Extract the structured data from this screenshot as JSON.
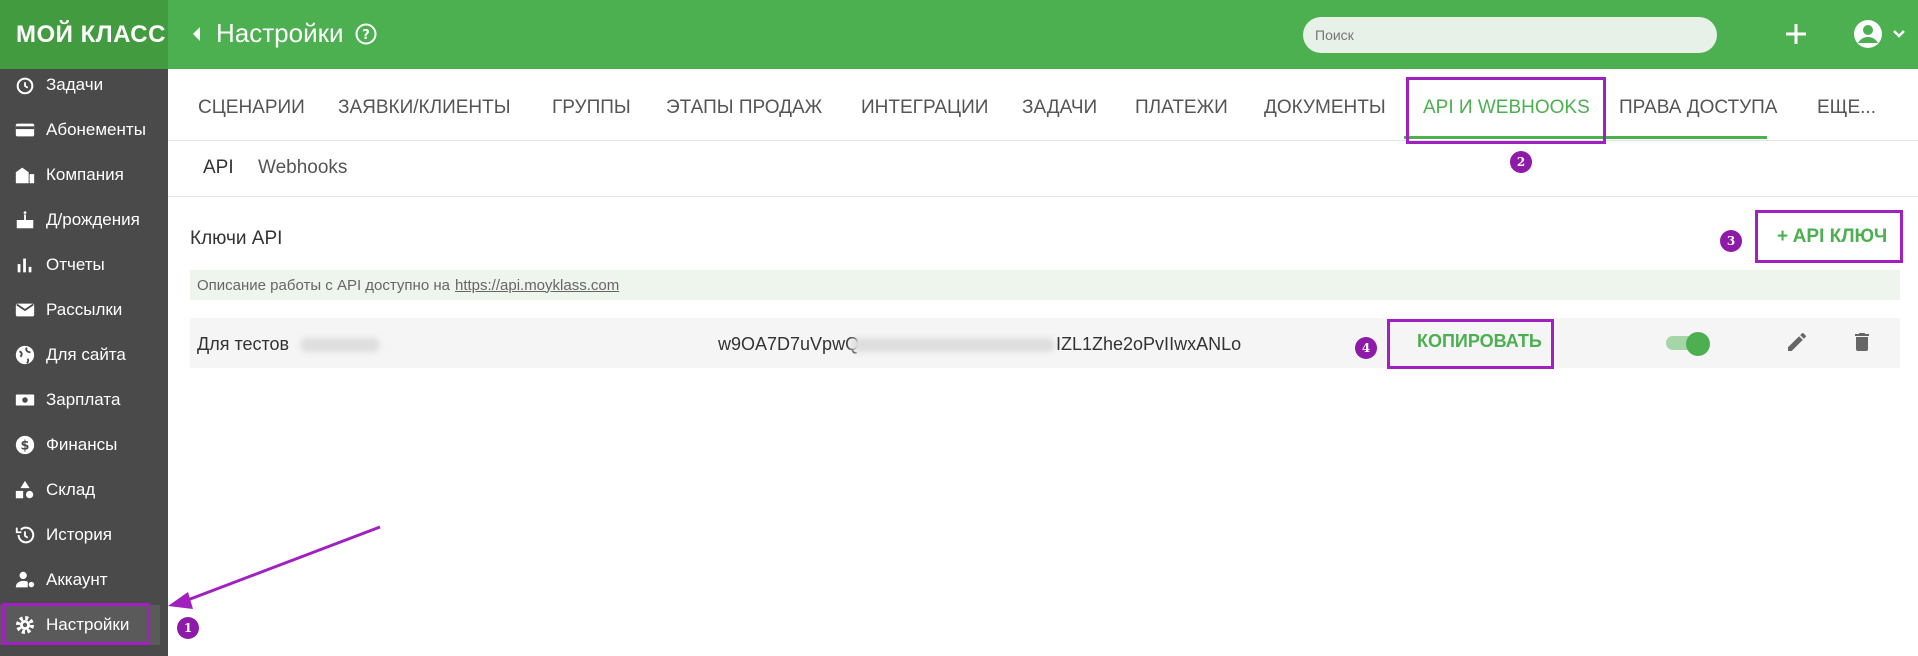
{
  "app": {
    "logo": "МОЙ КЛАСС"
  },
  "sidebar": {
    "items": [
      {
        "label": "Задачи",
        "icon": "clock-icon"
      },
      {
        "label": "Абонементы",
        "icon": "card-icon"
      },
      {
        "label": "Компания",
        "icon": "building-icon"
      },
      {
        "label": "Д/рождения",
        "icon": "cake-icon"
      },
      {
        "label": "Отчеты",
        "icon": "bar-chart-icon"
      },
      {
        "label": "Рассылки",
        "icon": "mail-icon"
      },
      {
        "label": "Для сайта",
        "icon": "globe-icon"
      },
      {
        "label": "Зарплата",
        "icon": "money-icon"
      },
      {
        "label": "Финансы",
        "icon": "dollar-icon"
      },
      {
        "label": "Склад",
        "icon": "shapes-icon"
      },
      {
        "label": "История",
        "icon": "history-icon"
      },
      {
        "label": "Аккаунт",
        "icon": "user-gear-icon"
      },
      {
        "label": "Настройки",
        "icon": "gear-icon"
      }
    ]
  },
  "header": {
    "title": "Настройки",
    "search_placeholder": "Поиск"
  },
  "tabs": [
    {
      "label": "СЦЕНАРИИ"
    },
    {
      "label": "ЗАЯВКИ/КЛИЕНТЫ"
    },
    {
      "label": "ГРУППЫ"
    },
    {
      "label": "ЭТАПЫ ПРОДАЖ"
    },
    {
      "label": "ИНТЕГРАЦИИ"
    },
    {
      "label": "ЗАДАЧИ"
    },
    {
      "label": "ПЛАТЕЖИ"
    },
    {
      "label": "ДОКУМЕНТЫ"
    },
    {
      "label": "API И WEBHOOKS"
    },
    {
      "label": "ПРАВА ДОСТУПА"
    },
    {
      "label": "ЕЩЕ..."
    }
  ],
  "subtabs": [
    {
      "label": "API"
    },
    {
      "label": "Webhooks"
    }
  ],
  "api": {
    "section_title": "Ключи API",
    "add_key_label": "+ API КЛЮЧ",
    "info_text": "Описание работы с API доступно на",
    "info_link": "https://api.moyklass.com",
    "keys": [
      {
        "name": "Для тестов",
        "key_start": "w9OA7D7uVpwQ",
        "key_end": "IZL1Zhe2oPvIIwxANLo",
        "copy_label": "КОПИРОВАТЬ",
        "enabled": true
      }
    ]
  },
  "annotations": {
    "b1": "1",
    "b2": "2",
    "b3": "3",
    "b4": "4"
  },
  "colors": {
    "brand_green": "#4caf50",
    "highlight_purple": "#a020c0"
  }
}
